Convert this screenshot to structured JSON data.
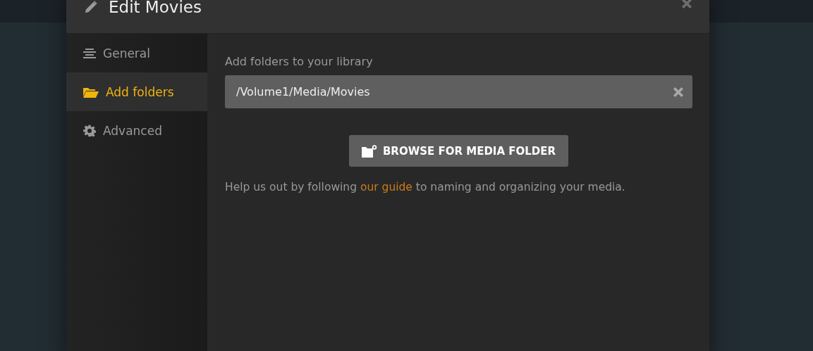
{
  "dialog": {
    "title": "Edit Movies"
  },
  "sidebar": {
    "items": [
      {
        "kind": "general",
        "label": "General",
        "selected": false
      },
      {
        "kind": "folders",
        "label": "Add folders",
        "selected": true
      },
      {
        "kind": "advanced",
        "label": "Advanced",
        "selected": false
      }
    ]
  },
  "content": {
    "section_label": "Add folders to your library",
    "folders": [
      {
        "value": "/Volume1/Media/Movies"
      }
    ],
    "browse_button": "BROWSE FOR MEDIA FOLDER",
    "help": {
      "before": "Help us out by following ",
      "link": "our guide",
      "after": " to naming and organizing your media."
    }
  }
}
